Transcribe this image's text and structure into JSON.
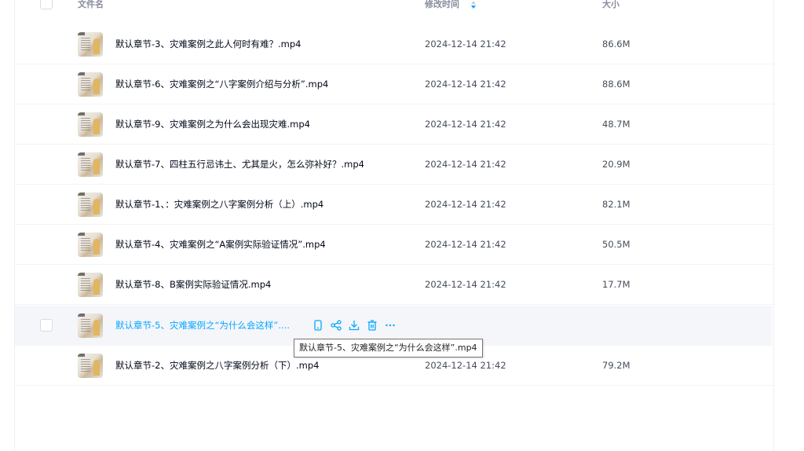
{
  "header": {
    "name_label": "文件名",
    "time_label": "修改时间",
    "size_label": "大小",
    "sort_icon": "sort-icon"
  },
  "files": [
    {
      "name": "默认章节-3、灾难案例之此人何时有难？.mp4",
      "time": "2024-12-14 21:42",
      "size": "86.6M"
    },
    {
      "name": "默认章节-6、灾难案例之“八字案例介绍与分析”.mp4",
      "time": "2024-12-14 21:42",
      "size": "88.6M"
    },
    {
      "name": "默认章节-9、灾难案例之为什么会出现灾难.mp4",
      "time": "2024-12-14 21:42",
      "size": "48.7M"
    },
    {
      "name": "默认章节-7、四柱五行忌讳土、尤其是火，怎么弥补好？.mp4",
      "time": "2024-12-14 21:42",
      "size": "20.9M"
    },
    {
      "name": "默认章节-1、：灾难案例之八字案例分析（上）.mp4",
      "time": "2024-12-14 21:42",
      "size": "82.1M"
    },
    {
      "name": "默认章节-4、灾难案例之“A案例实际验证情况”.mp4",
      "time": "2024-12-14 21:42",
      "size": "50.5M"
    },
    {
      "name": "默认章节-8、B案例实际验证情况.mp4",
      "time": "2024-12-14 21:42",
      "size": "17.7M"
    },
    {
      "name": "默认章节-5、灾难案例之“为什么会这样”....",
      "time": "",
      "size": ""
    },
    {
      "name": "默认章节-2、灾难案例之八字案例分析（下）.mp4",
      "time": "2024-12-14 21:42",
      "size": "79.2M"
    }
  ],
  "hover_actions": [
    "mobile-icon",
    "share-icon",
    "download-icon",
    "trash-icon",
    "more-icon"
  ],
  "tooltip": "默认章节-5、灾难案例之“为什么会这样”.mp4",
  "colors": {
    "accent": "#06a7ff",
    "text": "#03081a",
    "muted": "#878c9c",
    "hover_bg": "#f5f6fa"
  }
}
